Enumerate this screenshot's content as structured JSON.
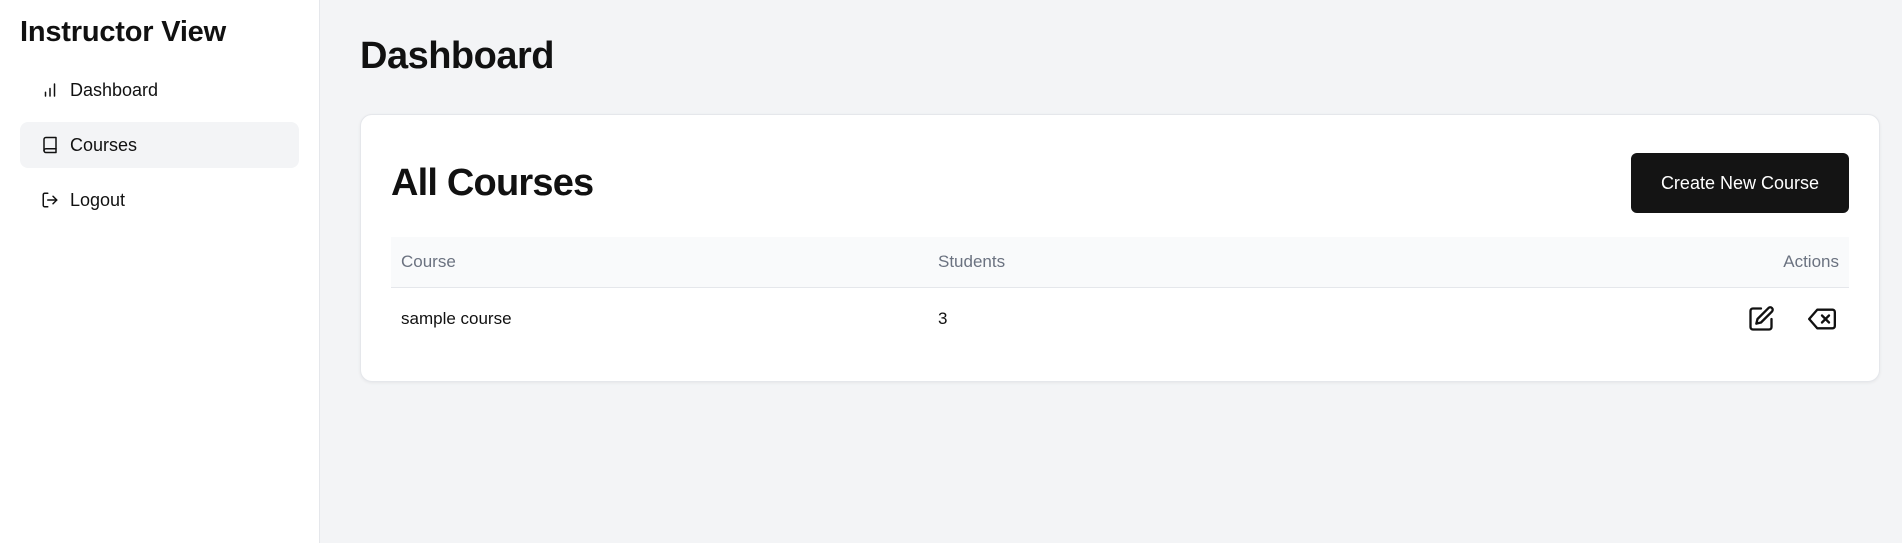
{
  "sidebar": {
    "title": "Instructor View",
    "items": [
      {
        "label": "Dashboard",
        "icon": "bar-chart-icon",
        "active": false
      },
      {
        "label": "Courses",
        "icon": "book-icon",
        "active": true
      },
      {
        "label": "Logout",
        "icon": "logout-icon",
        "active": false
      }
    ]
  },
  "main": {
    "page_title": "Dashboard",
    "card": {
      "title": "All Courses",
      "create_button_label": "Create New Course",
      "table": {
        "headers": [
          "Course",
          "Students",
          "Actions"
        ],
        "rows": [
          {
            "course": "sample course",
            "students": "3",
            "actions": [
              "edit-icon",
              "delete-icon"
            ]
          }
        ]
      }
    }
  },
  "colors": {
    "sidebar_bg": "#ffffff",
    "main_bg": "#f3f4f6",
    "active_nav_bg": "#f3f4f6",
    "primary_button_bg": "#141414",
    "primary_button_text": "#ffffff",
    "table_header_text": "#6b7280"
  }
}
